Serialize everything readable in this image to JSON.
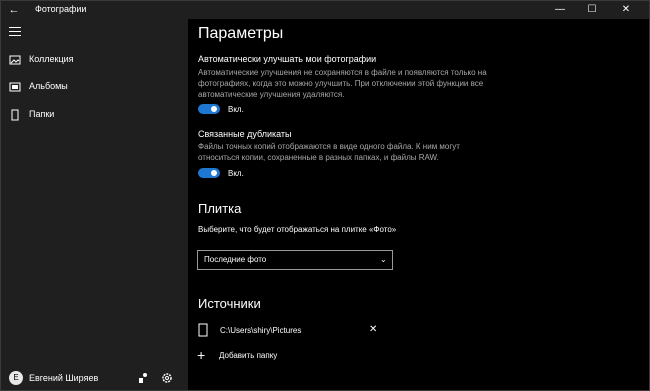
{
  "titlebar": {
    "back_glyph": "←",
    "title": "Фотографии",
    "min_glyph": "—",
    "max_glyph": "☐",
    "close_glyph": "✕"
  },
  "sidebar": {
    "items": [
      {
        "label": "Коллекция",
        "icon": "collection-icon"
      },
      {
        "label": "Альбомы",
        "icon": "album-icon"
      },
      {
        "label": "Папки",
        "icon": "folder-icon"
      }
    ],
    "user": {
      "name": "Евгений Ширяев",
      "avatar": "E"
    }
  },
  "main": {
    "title": "Параметры",
    "auto_enhance": {
      "title": "Автоматически улучшать мои фотографии",
      "desc": "Автоматические улучшения не сохраняются в файле и появляются только на фотографиях, когда это можно улучшить. При отключении этой функции все автоматические улучшения удаляются.",
      "toggle_label": "Вкл."
    },
    "duplicates": {
      "title": "Связанные дубликаты",
      "desc": "Файлы точных копий отображаются в виде одного файла. К ним могут относиться копии, сохраненные в разных папках, и файлы RAW.",
      "toggle_label": "Вкл."
    },
    "tile": {
      "heading": "Плитка",
      "prompt": "Выберите, что будет отображаться на плитке «Фото»",
      "selected": "Последние фото",
      "chevron": "⌄"
    },
    "sources": {
      "heading": "Источники",
      "folder_path": "C:\\Users\\shiry\\Pictures",
      "remove_glyph": "✕",
      "add_glyph": "+",
      "add_label": "Добавить папку"
    }
  },
  "colors": {
    "accent": "#1e78d2",
    "sidebar_bg": "#1f1f1f",
    "main_bg": "#000000"
  }
}
